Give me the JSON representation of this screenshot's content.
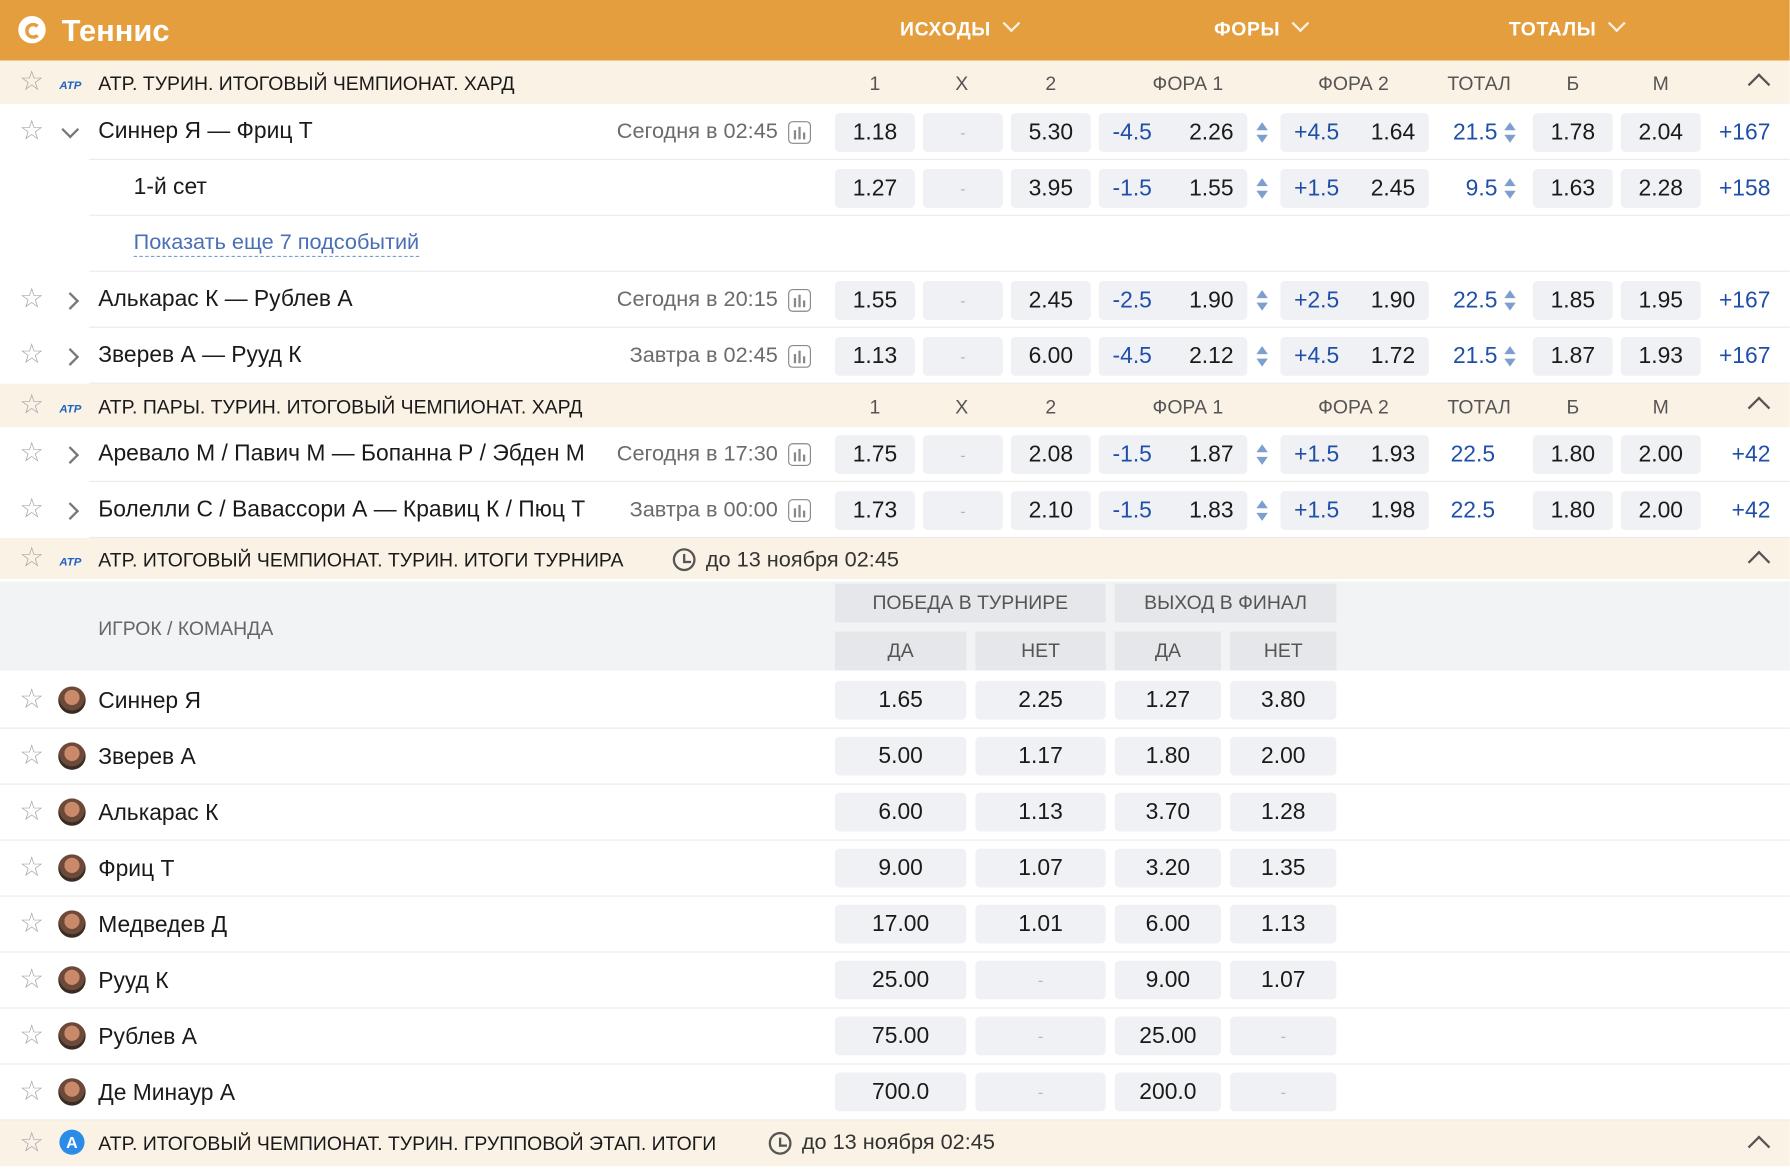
{
  "header": {
    "title": "Теннис",
    "tabs": [
      {
        "label": "ИСХОДЫ"
      },
      {
        "label": "ФОРЫ"
      },
      {
        "label": "ТОТАЛЫ"
      }
    ]
  },
  "columns": {
    "c1": "1",
    "cx": "X",
    "c2": "2",
    "f1": "ФОРА 1",
    "f2": "ФОРА 2",
    "tot": "ТОТАЛ",
    "b": "Б",
    "m": "М"
  },
  "leagues": [
    {
      "name": "ATP. ТУРИН. ИТОГОВЫЙ ЧЕМПИОНАТ. ХАРД"
    },
    {
      "name": "ATP. ПАРЫ. ТУРИН. ИТОГОВЫЙ ЧЕМПИОНАТ. ХАРД"
    },
    {
      "name": "ATP. ИТОГОВЫЙ ЧЕМПИОНАТ. ТУРИН. ИТОГИ ТУРНИРА",
      "deadline": "до 13 ноября 02:45"
    },
    {
      "name": "ATP. ИТОГОВЫЙ ЧЕМПИОНАТ. ТУРИН. ГРУППОВОЙ ЭТАП. ИТОГИ",
      "deadline": "до 13 ноября 02:45"
    }
  ],
  "matches": [
    {
      "name": "Синнер Я — Фриц Т",
      "time": "Сегодня в 02:45",
      "o1": "1.18",
      "ox": "-",
      "o2": "5.30",
      "h1": "-4.5",
      "h1o": "2.26",
      "h2": "+4.5",
      "h2o": "1.64",
      "total": "21.5",
      "b": "1.78",
      "m": "2.04",
      "more": "+167"
    },
    {
      "name": "1-й сет",
      "time": "",
      "o1": "1.27",
      "ox": "-",
      "o2": "3.95",
      "h1": "-1.5",
      "h1o": "1.55",
      "h2": "+1.5",
      "h2o": "2.45",
      "total": "9.5",
      "b": "1.63",
      "m": "2.28",
      "more": "+158"
    },
    {
      "name": "Алькарас К — Рублев А",
      "time": "Сегодня в 20:15",
      "o1": "1.55",
      "ox": "-",
      "o2": "2.45",
      "h1": "-2.5",
      "h1o": "1.90",
      "h2": "+2.5",
      "h2o": "1.90",
      "total": "22.5",
      "b": "1.85",
      "m": "1.95",
      "more": "+167"
    },
    {
      "name": "Зверев А — Рууд К",
      "time": "Завтра в 02:45",
      "o1": "1.13",
      "ox": "-",
      "o2": "6.00",
      "h1": "-4.5",
      "h1o": "2.12",
      "h2": "+4.5",
      "h2o": "1.72",
      "total": "21.5",
      "b": "1.87",
      "m": "1.93",
      "more": "+167"
    },
    {
      "name": "Аревало М / Павич М — Бопанна Р / Эбден М",
      "time": "Сегодня в 17:30",
      "o1": "1.75",
      "ox": "-",
      "o2": "2.08",
      "h1": "-1.5",
      "h1o": "1.87",
      "h2": "+1.5",
      "h2o": "1.93",
      "total": "22.5",
      "b": "1.80",
      "m": "2.00",
      "more": "+42"
    },
    {
      "name": "Болелли С / Вавассори А — Кравиц К / Пюц Т",
      "time": "Завтра в 00:00",
      "o1": "1.73",
      "ox": "-",
      "o2": "2.10",
      "h1": "-1.5",
      "h1o": "1.83",
      "h2": "+1.5",
      "h2o": "1.98",
      "total": "22.5",
      "b": "1.80",
      "m": "2.00",
      "more": "+42"
    }
  ],
  "show_more": "Показать еще 7 подсобытий",
  "outrights": {
    "player_label": "ИГРОК / КОМАНДА",
    "group1": "ПОБЕДА В ТУРНИРЕ",
    "group2": "ВЫХОД В ФИНАЛ",
    "yes": "ДА",
    "no": "НЕТ",
    "players": [
      {
        "name": "Синнер Я",
        "w_yes": "1.65",
        "w_no": "2.25",
        "f_yes": "1.27",
        "f_no": "3.80"
      },
      {
        "name": "Зверев А",
        "w_yes": "5.00",
        "w_no": "1.17",
        "f_yes": "1.80",
        "f_no": "2.00"
      },
      {
        "name": "Алькарас К",
        "w_yes": "6.00",
        "w_no": "1.13",
        "f_yes": "3.70",
        "f_no": "1.28"
      },
      {
        "name": "Фриц Т",
        "w_yes": "9.00",
        "w_no": "1.07",
        "f_yes": "3.20",
        "f_no": "1.35"
      },
      {
        "name": "Медведев Д",
        "w_yes": "17.00",
        "w_no": "1.01",
        "f_yes": "6.00",
        "f_no": "1.13"
      },
      {
        "name": "Рууд К",
        "w_yes": "25.00",
        "w_no": "-",
        "f_yes": "9.00",
        "f_no": "1.07"
      },
      {
        "name": "Рублев А",
        "w_yes": "75.00",
        "w_no": "-",
        "f_yes": "25.00",
        "f_no": "-"
      },
      {
        "name": "Де Минаур А",
        "w_yes": "700.0",
        "w_no": "-",
        "f_yes": "200.0",
        "f_no": "-"
      }
    ]
  },
  "colors": {
    "header_bg": "#e49e3e",
    "league_bg": "#fbf2e6",
    "odds_bg": "#f0f1f4",
    "link_blue": "#1f4fa8"
  }
}
